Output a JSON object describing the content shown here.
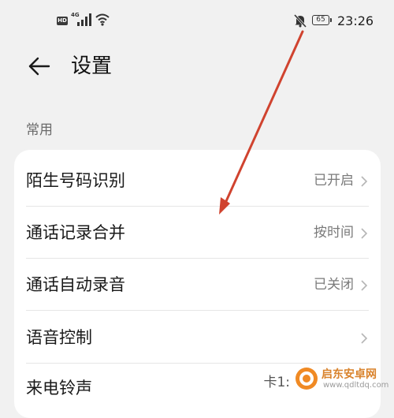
{
  "status_bar": {
    "hd_label": "HD",
    "network_label": "4G",
    "battery_level": "65",
    "time": "23:26",
    "icons": [
      "hd-icon",
      "signal-icon",
      "wifi-icon",
      "mute-bell-icon",
      "battery-icon"
    ]
  },
  "header": {
    "title": "设置",
    "back_icon": "arrow-left-icon"
  },
  "section": {
    "title": "常用"
  },
  "settings": [
    {
      "label": "陌生号码识别",
      "value": "已开启"
    },
    {
      "label": "通话记录合并",
      "value": "按时间"
    },
    {
      "label": "通话自动录音",
      "value": "已关闭"
    },
    {
      "label": "语音控制",
      "value": ""
    },
    {
      "label": "来电铃声",
      "value": "卡1:"
    }
  ],
  "annotation": {
    "color": "#d0432f"
  },
  "watermark": {
    "name": "启东安卓网",
    "url": "www.qdltdq.com"
  },
  "colors": {
    "background": "#f1f1f1",
    "card": "#ffffff",
    "secondary_text": "#7a7a7a"
  }
}
